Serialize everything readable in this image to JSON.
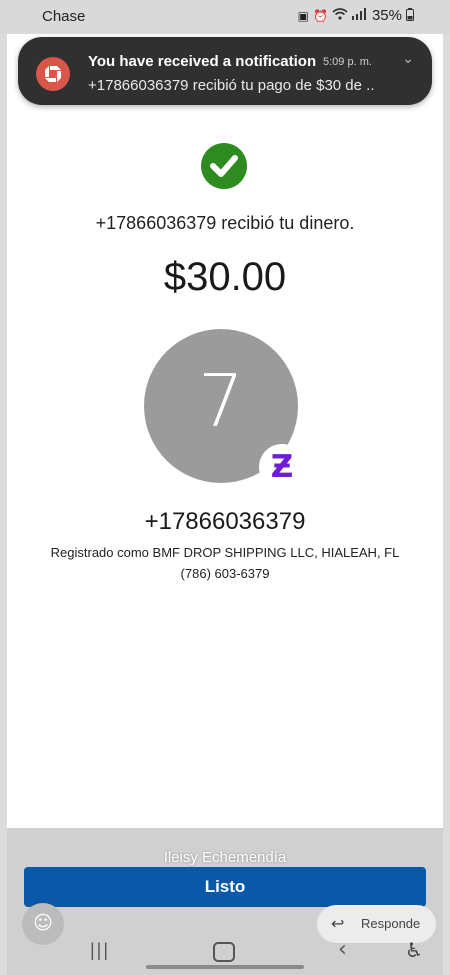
{
  "status_bar": {
    "carrier": "Chase",
    "icons": [
      "lock-icon",
      "alarm-icon",
      "wifi-icon",
      "signal-icon",
      "battery-icon"
    ],
    "battery_percent": "35%"
  },
  "notification": {
    "title": "You have received a notification",
    "time": "5:09 p. m.",
    "body": "+17866036379 recibió tu pago de $30 de .."
  },
  "confirmation": {
    "message": "+17866036379 recibió tu dinero.",
    "amount": "$30.00"
  },
  "recipient": {
    "initial": "7",
    "badge_glyph": "Ƶ",
    "phone": "+17866036379",
    "registered_as": "Registrado como BMF DROP SHIPPING LLC, HIALEAH, FL",
    "alt_phone": "(786) 603-6379"
  },
  "actions": {
    "reply_caption": "Ileisy  Echemendía",
    "done_label": "Listo",
    "reply_label": "Responde"
  },
  "colors": {
    "success_green": "#2e8b1f",
    "zelle_purple": "#6d1ed4",
    "button_blue": "#0b58a8",
    "chase_icon_bg": "#d9574a"
  }
}
